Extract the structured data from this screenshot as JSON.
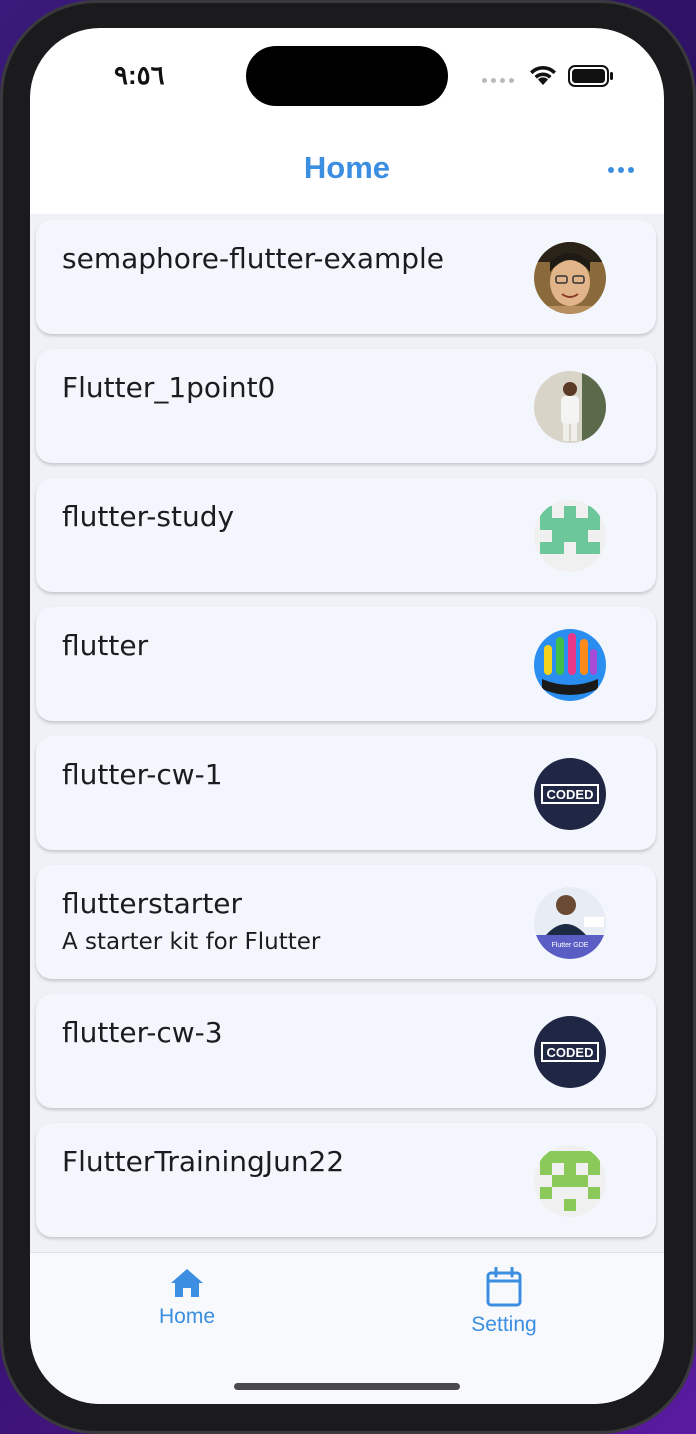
{
  "status_bar": {
    "time": "٩:٥٦"
  },
  "nav": {
    "title": "Home"
  },
  "repos": [
    {
      "name": "semaphore-flutter-example",
      "description": "",
      "avatar": "photo-person-glasses"
    },
    {
      "name": "Flutter_1point0",
      "description": "",
      "avatar": "photo-person-white-suit"
    },
    {
      "name": "flutter-study",
      "description": "",
      "avatar": "identicon-green"
    },
    {
      "name": "flutter",
      "description": "",
      "avatar": "raised-hands-logo"
    },
    {
      "name": "flutter-cw-1",
      "description": "",
      "avatar": "coded-logo",
      "avatar_text": "CODED"
    },
    {
      "name": "flutterstarter",
      "description": "A starter kit for Flutter",
      "avatar": "photo-flutter-gde",
      "avatar_text": "Flutter GDE"
    },
    {
      "name": "flutter-cw-3",
      "description": "",
      "avatar": "coded-logo",
      "avatar_text": "CODED"
    },
    {
      "name": "FlutterTrainingJun22",
      "description": "",
      "avatar": "identicon-lightgreen"
    }
  ],
  "tabs": [
    {
      "label": "Home",
      "icon": "home-icon",
      "selected": true
    },
    {
      "label": "Setting",
      "icon": "calendar-icon",
      "selected": false
    }
  ],
  "colors": {
    "accent": "#3b8ee0",
    "card": "#f3f7fd",
    "list_bg": "#eef1f6"
  }
}
